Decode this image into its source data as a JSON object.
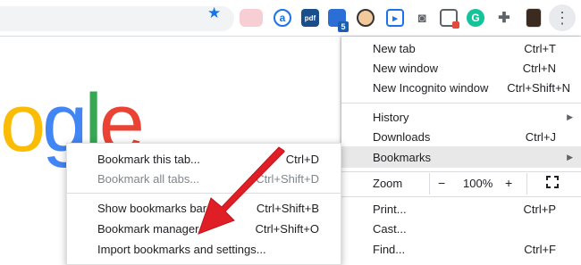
{
  "logo": {
    "letters": [
      {
        "ch": "o",
        "color": "#fbbc05"
      },
      {
        "ch": "g",
        "color": "#4285f4"
      },
      {
        "ch": "l",
        "color": "#34a853"
      },
      {
        "ch": "e",
        "color": "#ea4335"
      }
    ]
  },
  "toolbar": {
    "extensions": [
      "blurred-extension-icon",
      "a-icon",
      "pdf-icon",
      "cube-icon",
      "face-icon",
      "dashlane-icon",
      "camera-icon",
      "window-icon",
      "grammarly-icon",
      "puzzle-icon",
      "avatar-icon"
    ],
    "badge": "5",
    "a_label": "a",
    "pdf_label": "pdf",
    "g_label": "G",
    "kebab": "⋮"
  },
  "menu": {
    "new_tab": {
      "label": "New tab",
      "shortcut": "Ctrl+T"
    },
    "new_window": {
      "label": "New window",
      "shortcut": "Ctrl+N"
    },
    "incognito": {
      "label": "New Incognito window",
      "shortcut": "Ctrl+Shift+N"
    },
    "history": {
      "label": "History"
    },
    "downloads": {
      "label": "Downloads",
      "shortcut": "Ctrl+J"
    },
    "bookmarks": {
      "label": "Bookmarks"
    },
    "zoom": {
      "label": "Zoom",
      "minus": "−",
      "value": "100%",
      "plus": "+"
    },
    "print": {
      "label": "Print...",
      "shortcut": "Ctrl+P"
    },
    "cast": {
      "label": "Cast..."
    },
    "find": {
      "label": "Find...",
      "shortcut": "Ctrl+F"
    }
  },
  "submenu": {
    "bookmark_tab": {
      "label": "Bookmark this tab...",
      "shortcut": "Ctrl+D"
    },
    "bookmark_all": {
      "label": "Bookmark all tabs...",
      "shortcut": "Ctrl+Shift+D"
    },
    "show_bar": {
      "label": "Show bookmarks bar",
      "shortcut": "Ctrl+Shift+B"
    },
    "manager": {
      "label": "Bookmark manager",
      "shortcut": "Ctrl+Shift+O"
    },
    "import": {
      "label": "Import bookmarks and settings..."
    }
  },
  "colors": {
    "accent": "#1a73e8",
    "highlight": "#e8e8e8",
    "arrow": "#e01e26"
  }
}
